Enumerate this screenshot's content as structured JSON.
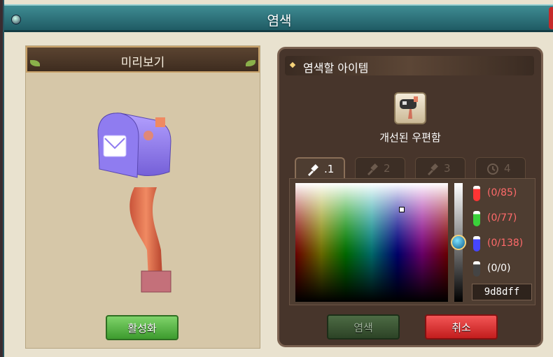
{
  "window": {
    "title": "염색"
  },
  "preview": {
    "header": "미리보기",
    "activate_label": "활성화"
  },
  "dye_panel": {
    "header": "염색할 아이템",
    "item_name": "개선된 우편함",
    "tabs": [
      {
        "label": ".1",
        "active": true,
        "icon": "brush-icon"
      },
      {
        "label": "2",
        "active": false,
        "icon": "brush-icon"
      },
      {
        "label": "3",
        "active": false,
        "icon": "brush-icon"
      },
      {
        "label": "4",
        "active": false,
        "icon": "history-icon"
      }
    ],
    "channels": [
      {
        "value": "(0/85)",
        "color": "#ff5a5a"
      },
      {
        "value": "(0/77)",
        "color": "#ff5a5a"
      },
      {
        "value": "(0/138)",
        "color": "#ff5a5a"
      },
      {
        "value": "(0/0)",
        "color": "#ffffff"
      }
    ],
    "hex": "9d8dff",
    "dye_label": "염색",
    "cancel_label": "취소"
  },
  "colors": {
    "accent": "#1f5b64",
    "selected": "#9d8dff"
  }
}
